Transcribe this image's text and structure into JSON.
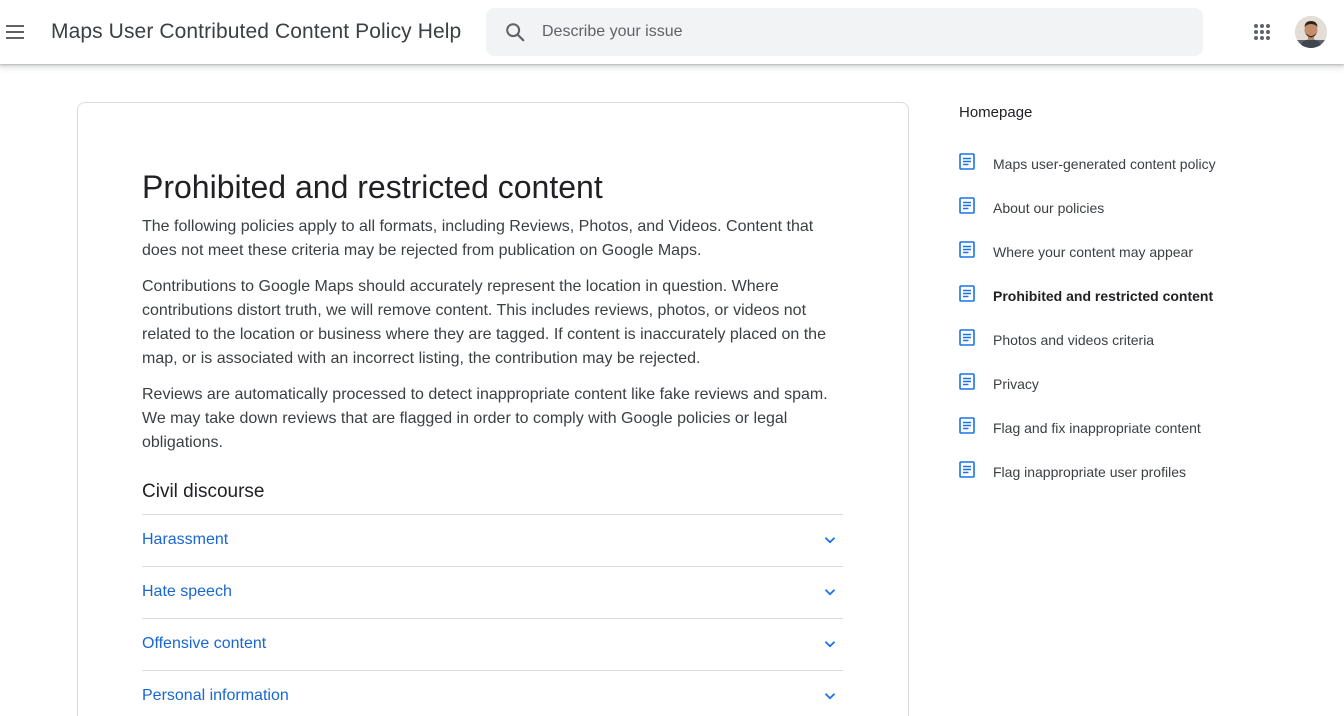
{
  "header": {
    "title": "Maps User Contributed Content Policy Help",
    "search_placeholder": "Describe your issue"
  },
  "article": {
    "title": "Prohibited and restricted content",
    "paragraphs": [
      "The following policies apply to all formats, including Reviews, Photos, and Videos. Content that does not meet these criteria may be rejected from publication on Google Maps.",
      "Contributions to Google Maps should accurately represent the location in question. Where contributions distort truth, we will remove content. This includes reviews, photos, or videos not related to the location or business where they are tagged. If content is inaccurately placed on the map, or is associated with an incorrect listing, the contribution may be rejected.",
      "Reviews are automatically processed to detect inappropriate content like fake reviews and spam. We may take down reviews that are flagged in order to comply with Google policies or legal obligations."
    ],
    "section_title": "Civil discourse",
    "accordion": [
      {
        "label": "Harassment",
        "icon": "chevron-down-icon"
      },
      {
        "label": "Hate speech",
        "icon": "chevron-down-icon"
      },
      {
        "label": "Offensive content",
        "icon": "chevron-down-icon"
      },
      {
        "label": "Personal information",
        "icon": "chevron-down-icon"
      }
    ]
  },
  "sidebar": {
    "home_label": "Homepage",
    "items": [
      {
        "label": "Maps user-generated content policy",
        "icon": "article-icon"
      },
      {
        "label": "About our policies",
        "icon": "article-icon"
      },
      {
        "label": "Where your content may appear",
        "icon": "article-icon"
      },
      {
        "label": "Prohibited and restricted content",
        "icon": "article-icon",
        "active": true
      },
      {
        "label": "Photos and videos criteria",
        "icon": "article-icon"
      },
      {
        "label": "Privacy",
        "icon": "article-icon"
      },
      {
        "label": "Flag and fix inappropriate content",
        "icon": "article-icon"
      },
      {
        "label": "Flag inappropriate user profiles",
        "icon": "article-icon"
      }
    ]
  },
  "colors": {
    "link": "#1967d2",
    "icon_blue": "#1a73e8",
    "text": "#3c4043",
    "search_bg": "#f1f3f4",
    "divider": "#dadce0"
  }
}
